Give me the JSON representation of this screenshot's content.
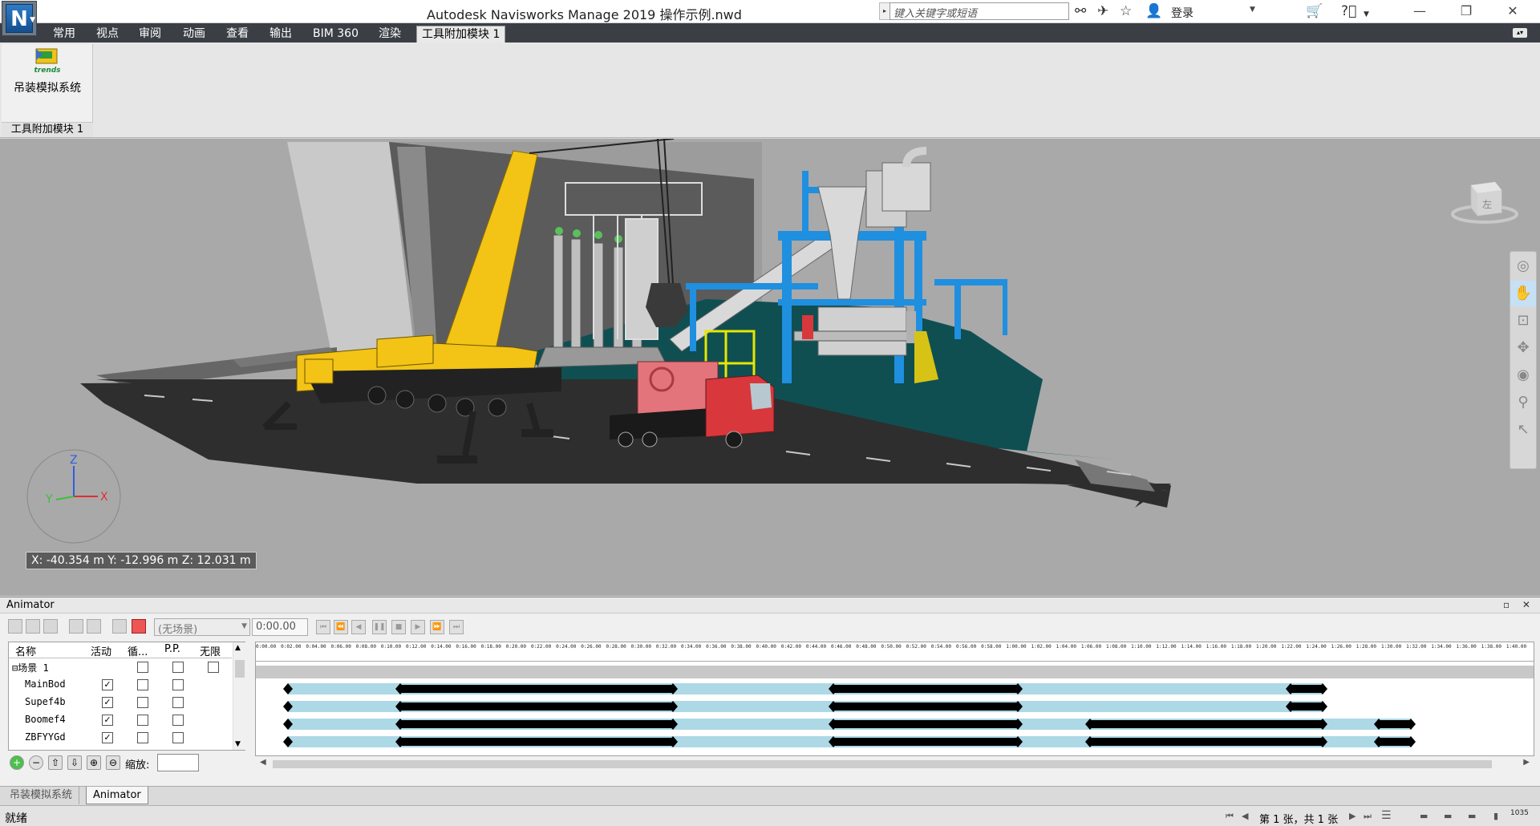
{
  "window": {
    "title": "Autodesk Navisworks Manage 2019    操作示例.nwd",
    "search_placeholder": "键入关键字或短语",
    "login_label": "登录",
    "app_logo_letter": "N"
  },
  "ribbon": {
    "tabs": [
      "常用",
      "视点",
      "审阅",
      "动画",
      "查看",
      "输出",
      "BIM 360",
      "渲染",
      "工具附加模块 1"
    ],
    "active_tab": "工具附加模块 1",
    "button_label": "吊装模拟系统",
    "panel_label": "工具附加模块 1",
    "logo_text": "trends"
  },
  "viewport": {
    "coordinates": "X: -40.354 m  Y: -12.996 m  Z: 12.031 m",
    "viewcube_label": "左",
    "axis_labels": {
      "x": "X",
      "y": "Y",
      "z": "Z"
    }
  },
  "animator": {
    "title": "Animator",
    "scene_select": "(无场景)",
    "time_value": "0:00.00",
    "columns": [
      "名称",
      "活动",
      "循...",
      "P.P.",
      "无限"
    ],
    "rows": [
      {
        "name": "⊟场景 1",
        "active": false,
        "loop": false,
        "pp": false,
        "infinite": false
      },
      {
        "name": "MainBod",
        "active": true,
        "loop": false,
        "pp": false
      },
      {
        "name": "Supef4b",
        "active": true,
        "loop": false,
        "pp": false
      },
      {
        "name": "Boomef4",
        "active": true,
        "loop": false,
        "pp": false
      },
      {
        "name": "ZBFYYGd",
        "active": true,
        "loop": false,
        "pp": false
      }
    ],
    "zoom_label": "缩放:",
    "ruler_ticks": [
      "0:00.00",
      "0:02.00",
      "0:04.00",
      "0:06.00",
      "0:08.00",
      "0:10.00",
      "0:12.00",
      "0:14.00",
      "0:16.00",
      "0:18.00",
      "0:20.00",
      "0:22.00",
      "0:24.00",
      "0:26.00",
      "0:28.00",
      "0:30.00",
      "0:32.00",
      "0:34.00",
      "0:36.00",
      "0:38.00",
      "0:40.00",
      "0:42.00",
      "0:44.00",
      "0:46.00",
      "0:48.00",
      "0:50.00",
      "0:52.00",
      "0:54.00",
      "0:56.00",
      "0:58.00",
      "1:00.00",
      "1:02.00",
      "1:04.00",
      "1:06.00",
      "1:08.00",
      "1:10.00",
      "1:12.00",
      "1:14.00",
      "1:16.00",
      "1:18.00",
      "1:20.00",
      "1:22.00",
      "1:24.00",
      "1:26.00",
      "1:28.00",
      "1:30.00",
      "1:32.00",
      "1:34.00",
      "1:36.00",
      "1:38.00",
      "1:40.00"
    ]
  },
  "dock_tabs": [
    "吊装模拟系统",
    "Animator"
  ],
  "status": {
    "text": "就绪",
    "page_info": "第 1 张，共 1 张",
    "memory": "1035"
  },
  "colors": {
    "track": "#add8e6",
    "keyframe": "#000000",
    "road": "#2e2e2e",
    "floor": "#0f4f52",
    "crane": "#f3c316",
    "frame": "#1f8fe0",
    "truck": "#d8373c"
  }
}
